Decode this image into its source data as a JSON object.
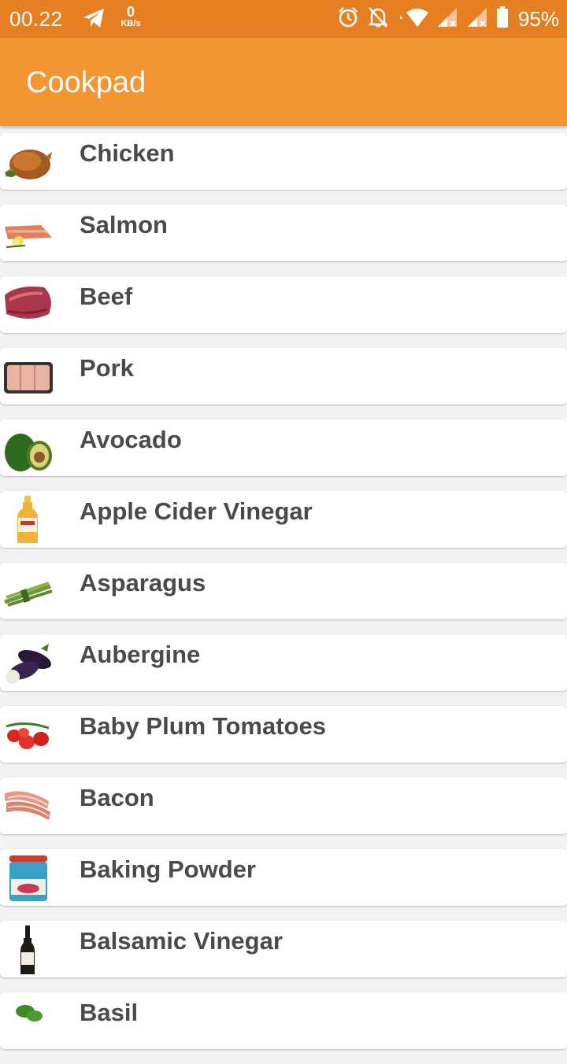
{
  "status_bar": {
    "time": "00.22",
    "net_speed_value": "0",
    "net_speed_unit": "KB/s",
    "battery_percent": "95%",
    "icons": [
      "telegram-icon",
      "alarm-icon",
      "notifications-off-icon",
      "wifi-icon",
      "signal-icon",
      "signal-icon",
      "battery-icon"
    ]
  },
  "app_bar": {
    "title": "Cookpad"
  },
  "ingredients": [
    {
      "label": "Chicken",
      "icon": "chicken-thumbnail"
    },
    {
      "label": "Salmon",
      "icon": "salmon-thumbnail"
    },
    {
      "label": "Beef",
      "icon": "beef-thumbnail"
    },
    {
      "label": "Pork",
      "icon": "pork-thumbnail"
    },
    {
      "label": "Avocado",
      "icon": "avocado-thumbnail"
    },
    {
      "label": "Apple Cider Vinegar",
      "icon": "vinegar-bottle-thumbnail"
    },
    {
      "label": "Asparagus",
      "icon": "asparagus-thumbnail"
    },
    {
      "label": "Aubergine",
      "icon": "aubergine-thumbnail"
    },
    {
      "label": "Baby Plum Tomatoes",
      "icon": "tomatoes-thumbnail"
    },
    {
      "label": "Bacon",
      "icon": "bacon-thumbnail"
    },
    {
      "label": "Baking Powder",
      "icon": "baking-powder-thumbnail"
    },
    {
      "label": "Balsamic Vinegar",
      "icon": "balsamic-bottle-thumbnail"
    },
    {
      "label": "Basil",
      "icon": "basil-thumbnail"
    }
  ],
  "colors": {
    "status_bar": "#e67e22",
    "app_bar": "#f39530",
    "list_background": "#f2f2f2",
    "label_text": "#4a4a4a"
  }
}
